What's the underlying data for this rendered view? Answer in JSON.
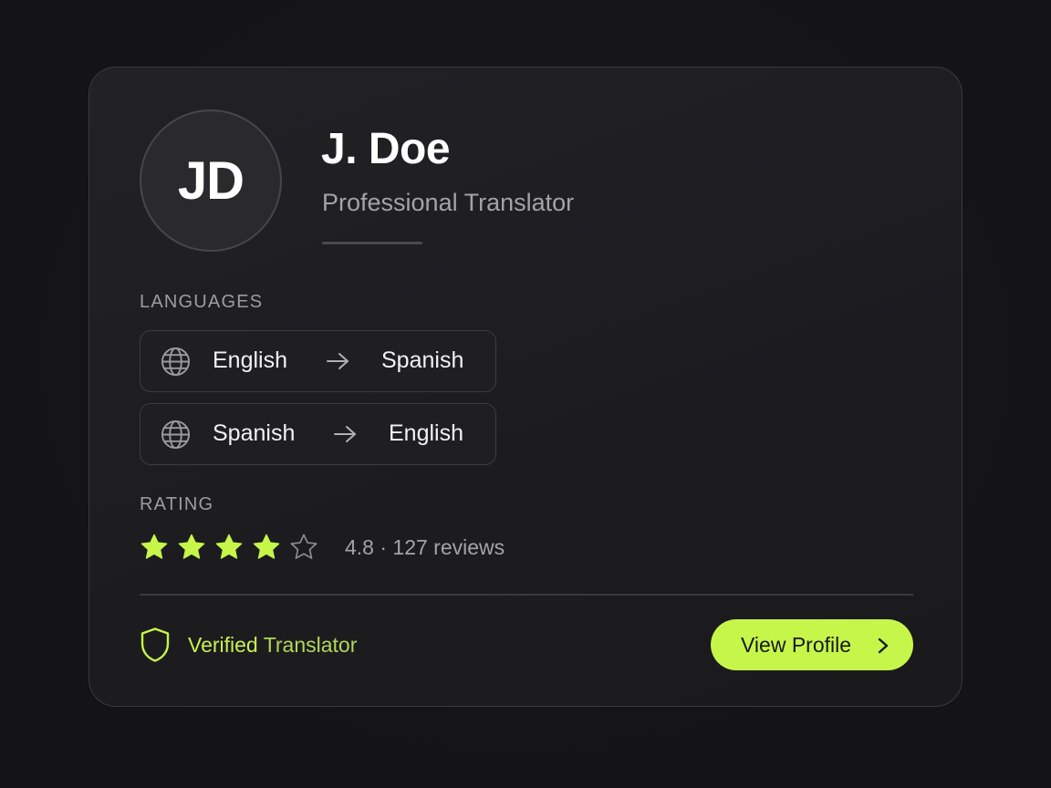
{
  "profile": {
    "initials": "JD",
    "name": "J. Doe",
    "role": "Professional Translator"
  },
  "languages": {
    "label": "LANGUAGES",
    "pairs": [
      {
        "from": "English",
        "to": "Spanish",
        "icon": "globe-icon",
        "arrow_icon": "arrow-right-icon"
      },
      {
        "from": "Spanish",
        "to": "English",
        "icon": "globe-icon",
        "arrow_icon": "arrow-right-icon"
      }
    ]
  },
  "rating": {
    "label": "RATING",
    "stars_filled": 4,
    "stars_total": 5,
    "summary": "4.8 · 127 reviews",
    "star_color": "#c6f64a"
  },
  "footer": {
    "verified_part1": "Verified",
    "verified_part2": "Translator",
    "verified_icon": "shield-icon",
    "button_label": "View Profile",
    "button_icon": "chevron-right-icon",
    "accent_color": "#c6f64a"
  }
}
